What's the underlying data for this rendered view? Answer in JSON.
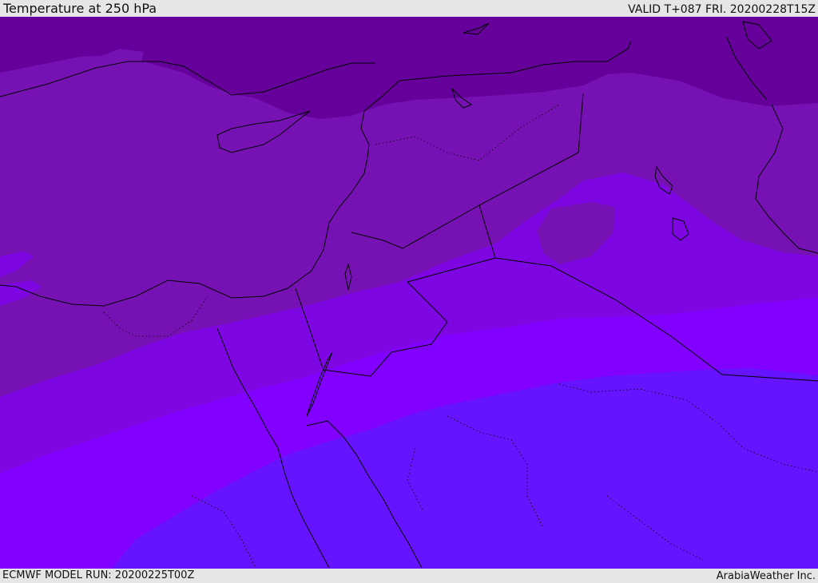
{
  "header": {
    "title": "Temperature at 250 hPa",
    "valid": "VALID T+087 FRI. 20200228T15Z"
  },
  "footer": {
    "model_run": "ECMWF MODEL RUN: 20200225T00Z",
    "credit": "ArabiaWeather Inc."
  },
  "map": {
    "colors": {
      "band_darkest": "#66009b",
      "band_dark": "#7612b3",
      "band_mid": "#7e06e2",
      "band_bright": "#8200ff",
      "band_blue": "#6614ff",
      "coastline": "#000000"
    }
  }
}
